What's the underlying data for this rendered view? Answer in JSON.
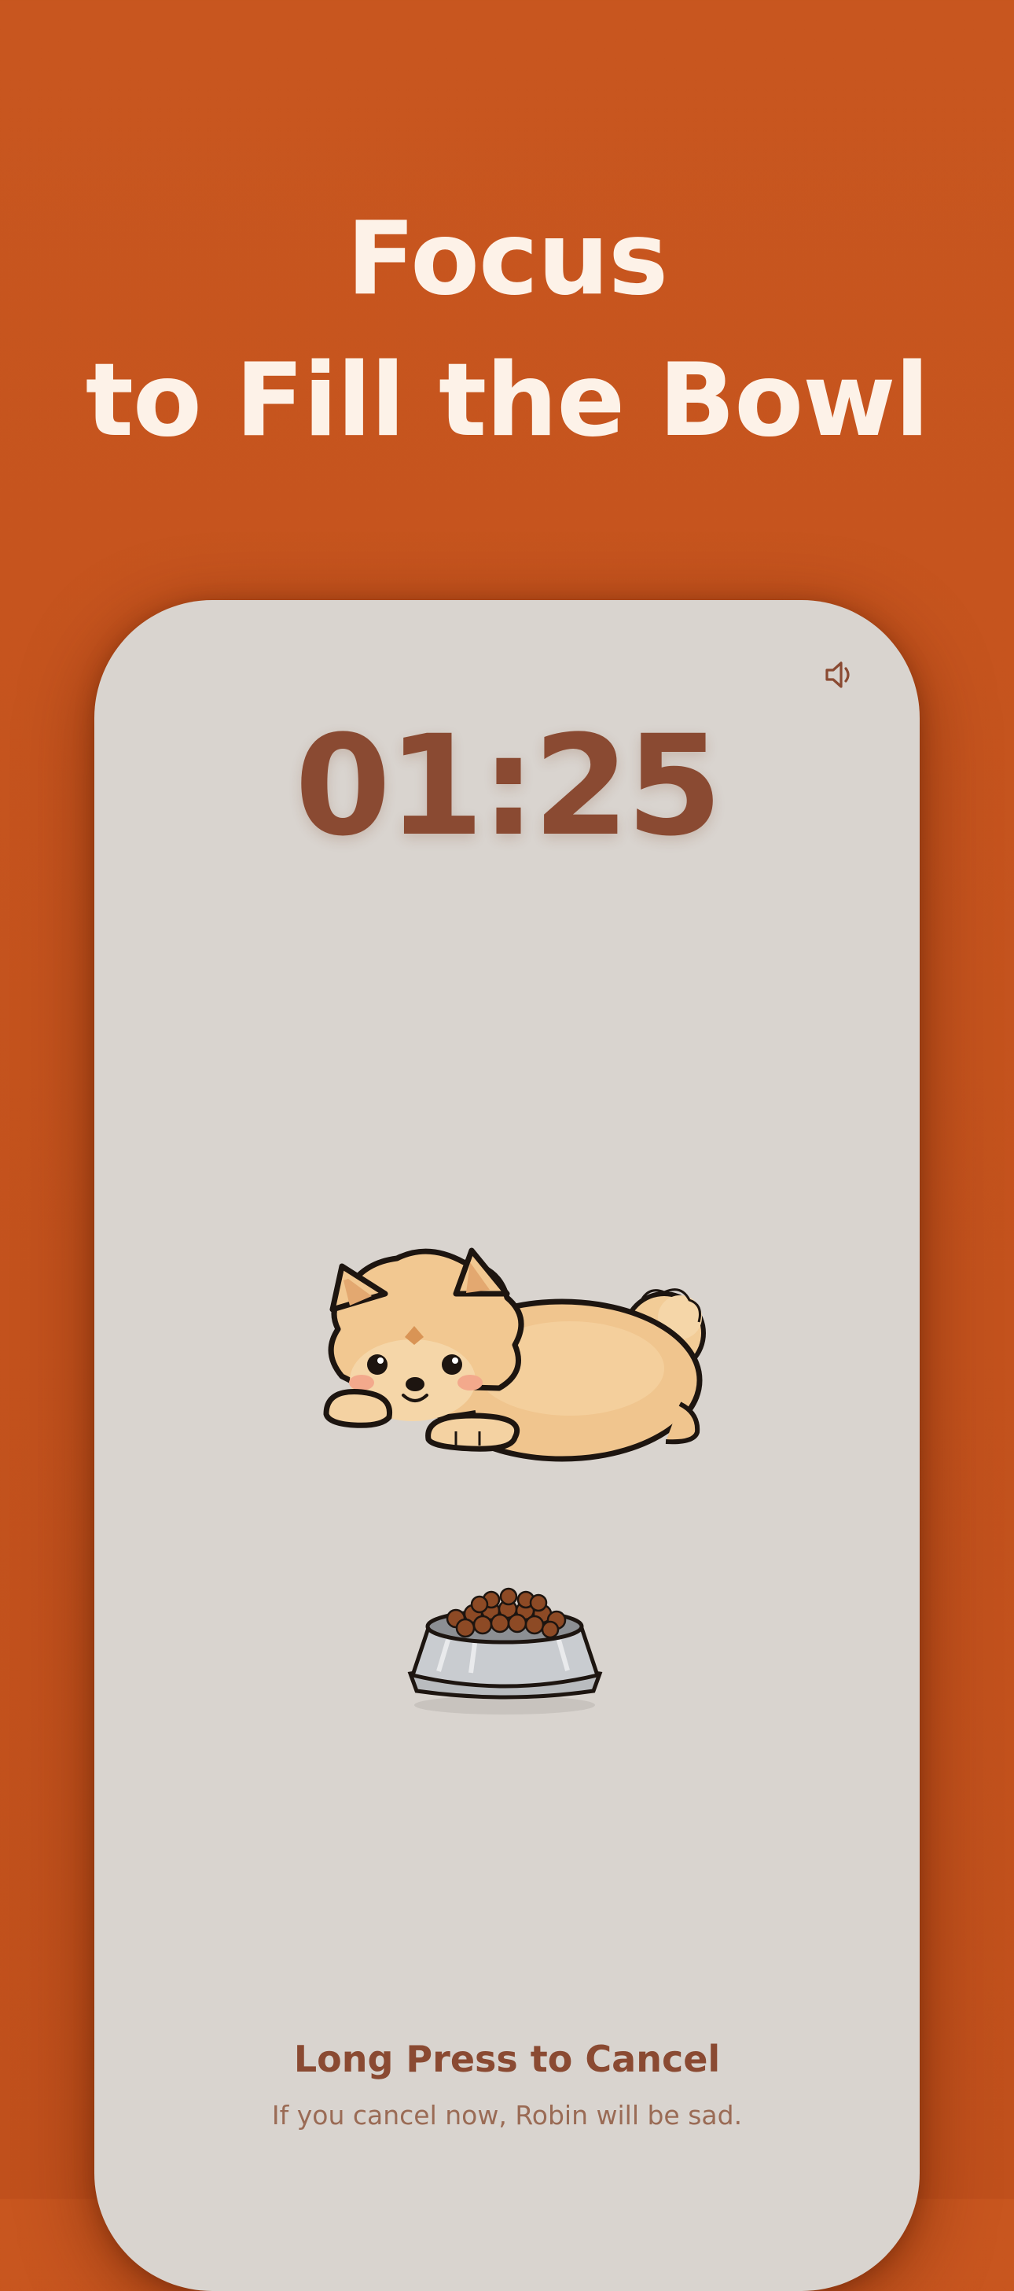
{
  "headline": {
    "line1": "Focus",
    "line2": "to Fill the Bowl"
  },
  "timer": {
    "display": "01:25"
  },
  "sound": {
    "icon": "speaker-icon"
  },
  "pet": {
    "icon": "pomeranian-dog-illustration"
  },
  "bowl": {
    "icon": "food-bowl-illustration"
  },
  "cancel": {
    "title": "Long Press to Cancel",
    "subtitle": "If you cancel now, Robin will be sad."
  },
  "colors": {
    "background": "#c8561f",
    "headline": "#fdf2e8",
    "card": "#d9d4cf",
    "accent": "#8a4a32",
    "subtle_text": "#9a6b55"
  }
}
